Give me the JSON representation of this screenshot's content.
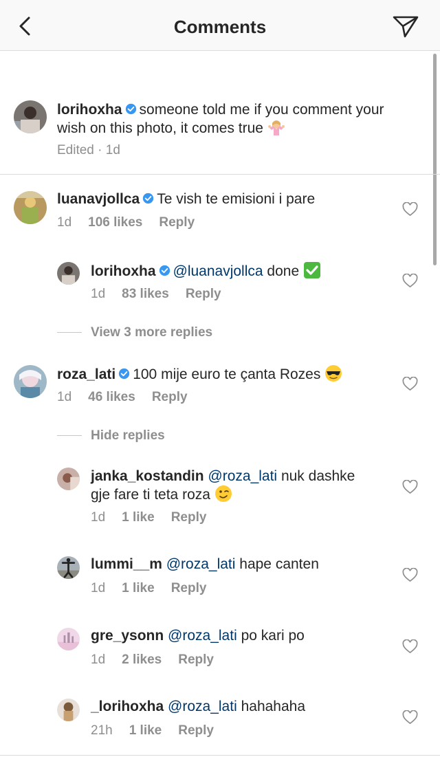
{
  "header": {
    "title": "Comments",
    "back_icon": "chevron-left-icon",
    "send_icon": "paper-plane-icon"
  },
  "caption": {
    "username": "lorihoxha",
    "text": "someone told me if you comment your wish on this photo, it comes true",
    "emoji": "🤷‍♀️",
    "edited": "Edited",
    "time": "1d"
  },
  "comments": [
    {
      "username": "luanavjollca",
      "verified": true,
      "text": "Te vish te emisioni i pare",
      "time": "1d",
      "likes": "106 likes",
      "reply_label": "Reply",
      "replies": [
        {
          "username": "lorihoxha",
          "verified": true,
          "mention": "@luanavjollca",
          "text": "done",
          "emoji": "✅",
          "time": "1d",
          "likes": "83 likes",
          "reply_label": "Reply"
        }
      ],
      "toggle_label": "View 3 more replies"
    },
    {
      "username": "roza_lati",
      "verified": true,
      "text": "100 mije euro te çanta Rozes",
      "emoji": "😎",
      "time": "1d",
      "likes": "46 likes",
      "reply_label": "Reply",
      "toggle_label": "Hide replies",
      "replies": [
        {
          "username": "janka_kostandin",
          "mention": "@roza_lati",
          "text": "nuk dashke",
          "text2": "gje fare ti teta roza",
          "emoji": "😉",
          "time": "1d",
          "likes": "1 like",
          "reply_label": "Reply"
        },
        {
          "username": "lummi__m",
          "mention": "@roza_lati",
          "text": "hape canten",
          "time": "1d",
          "likes": "1 like",
          "reply_label": "Reply"
        },
        {
          "username": "gre_ysonn",
          "mention": "@roza_lati",
          "text": "po kari po",
          "time": "1d",
          "likes": "2 likes",
          "reply_label": "Reply"
        },
        {
          "username": "_lorihoxha",
          "mention": "@roza_lati",
          "text": "hahahaha",
          "time": "21h",
          "likes": "1 like",
          "reply_label": "Reply"
        }
      ]
    }
  ],
  "colors": {
    "verified": "#3897f0",
    "mention": "#00376b",
    "meta": "#8e8e8e"
  }
}
